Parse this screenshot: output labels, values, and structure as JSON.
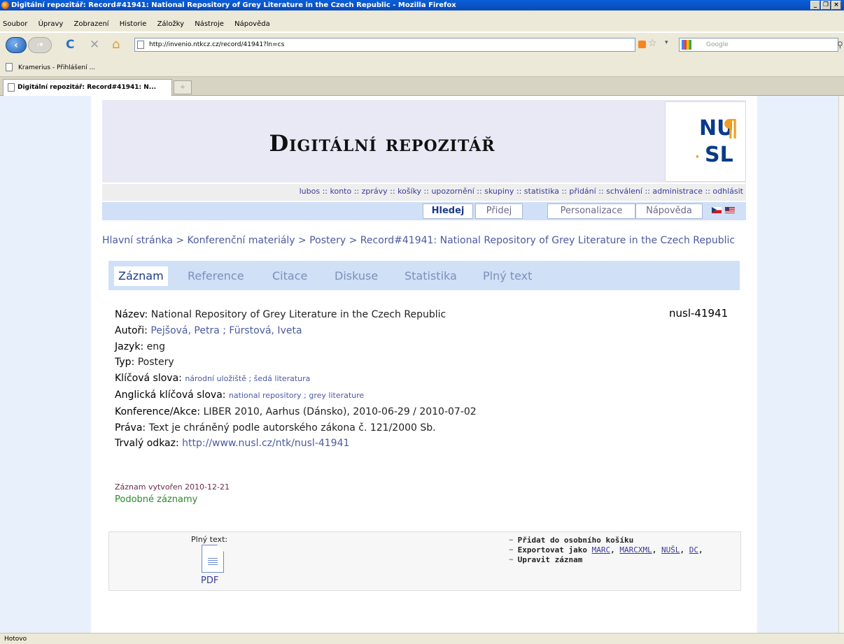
{
  "window": {
    "title": "Digitální repozitář: Record#41941: National Repository of Grey Literature in the Czech Republic - Mozilla Firefox",
    "min": "_",
    "max": "❐",
    "close": "×"
  },
  "menu": [
    "Soubor",
    "Úpravy",
    "Zobrazení",
    "Historie",
    "Záložky",
    "Nástroje",
    "Nápověda"
  ],
  "nav": {
    "url": "http://invenio.ntkcz.cz/record/41941?ln=cs",
    "search_placeholder": "Google"
  },
  "bookmarks": {
    "item1": "Kramerius - Přihlášení ..."
  },
  "tabs": {
    "active": "Digitální repozitář: Record#41941: N...",
    "new": "+"
  },
  "site": {
    "title": "Digitální repozitář",
    "logo_top": "NU",
    "logo_para": "¶",
    "logo_bottom": "SL",
    "logo_dot": "·",
    "userbar": "lubos :: konto :: zprávy :: košíky :: upozornění :: skupiny :: statistika :: přidání :: schválení :: administrace :: odhlásit",
    "navtabs": [
      "Hledej",
      "Přidej",
      "Personalizace",
      "Nápověda"
    ],
    "breadcrumb": "Hlavní stránka > Konferenční materiály > Postery > Record#41941: National Repository of Grey Literature in the Czech Republic"
  },
  "record_tabs": [
    "Záznam",
    "Reference",
    "Citace",
    "Diskuse",
    "Statistika",
    "Plný text"
  ],
  "record": {
    "id": "nusl-41941",
    "title_label": "Název:",
    "title": "National Repository of Grey Literature in the Czech Republic",
    "authors_label": "Autoři:",
    "author1": "Pejšová, Petra",
    "author_sep": " ; ",
    "author2": "Fürstová, Iveta",
    "lang_label": "Jazyk:",
    "lang": "eng",
    "type_label": "Typ:",
    "type": "Postery",
    "kw_label": "Klíčová slova:",
    "kw1": "národní uložiště",
    "kw_sep": " ; ",
    "kw2": "šedá literatura",
    "ekw_label": "Anglická klíčová slova:",
    "ekw1": "national repository",
    "ekw_sep": " ; ",
    "ekw2": "grey literature",
    "conf_label": "Konference/Akce:",
    "conf": "LIBER 2010, Aarhus (Dánsko), 2010-06-29 / 2010-07-02",
    "rights_label": "Práva:",
    "rights": "Text je chráněný podle autorského zákona č. 121/2000 Sb.",
    "link_label": "Trvalý odkaz:",
    "link": "http://www.nusl.cz/ntk/nusl-41941",
    "created": "Záznam vytvořen 2010-12-21",
    "similar": "Podobné záznamy"
  },
  "bottom": {
    "fulltext_label": "Plný text:",
    "pdf": "PDF",
    "arrow": "➡",
    "action1": "Přidat do osobního košíku",
    "action2": "Exportovat jako",
    "fmt1": "MARC",
    "fmt2": "MARCXML",
    "fmt3": "NUŠL",
    "fmt4": "DC",
    "comma": ",",
    "action3": "Upravit záznam"
  },
  "status": "Hotovo"
}
